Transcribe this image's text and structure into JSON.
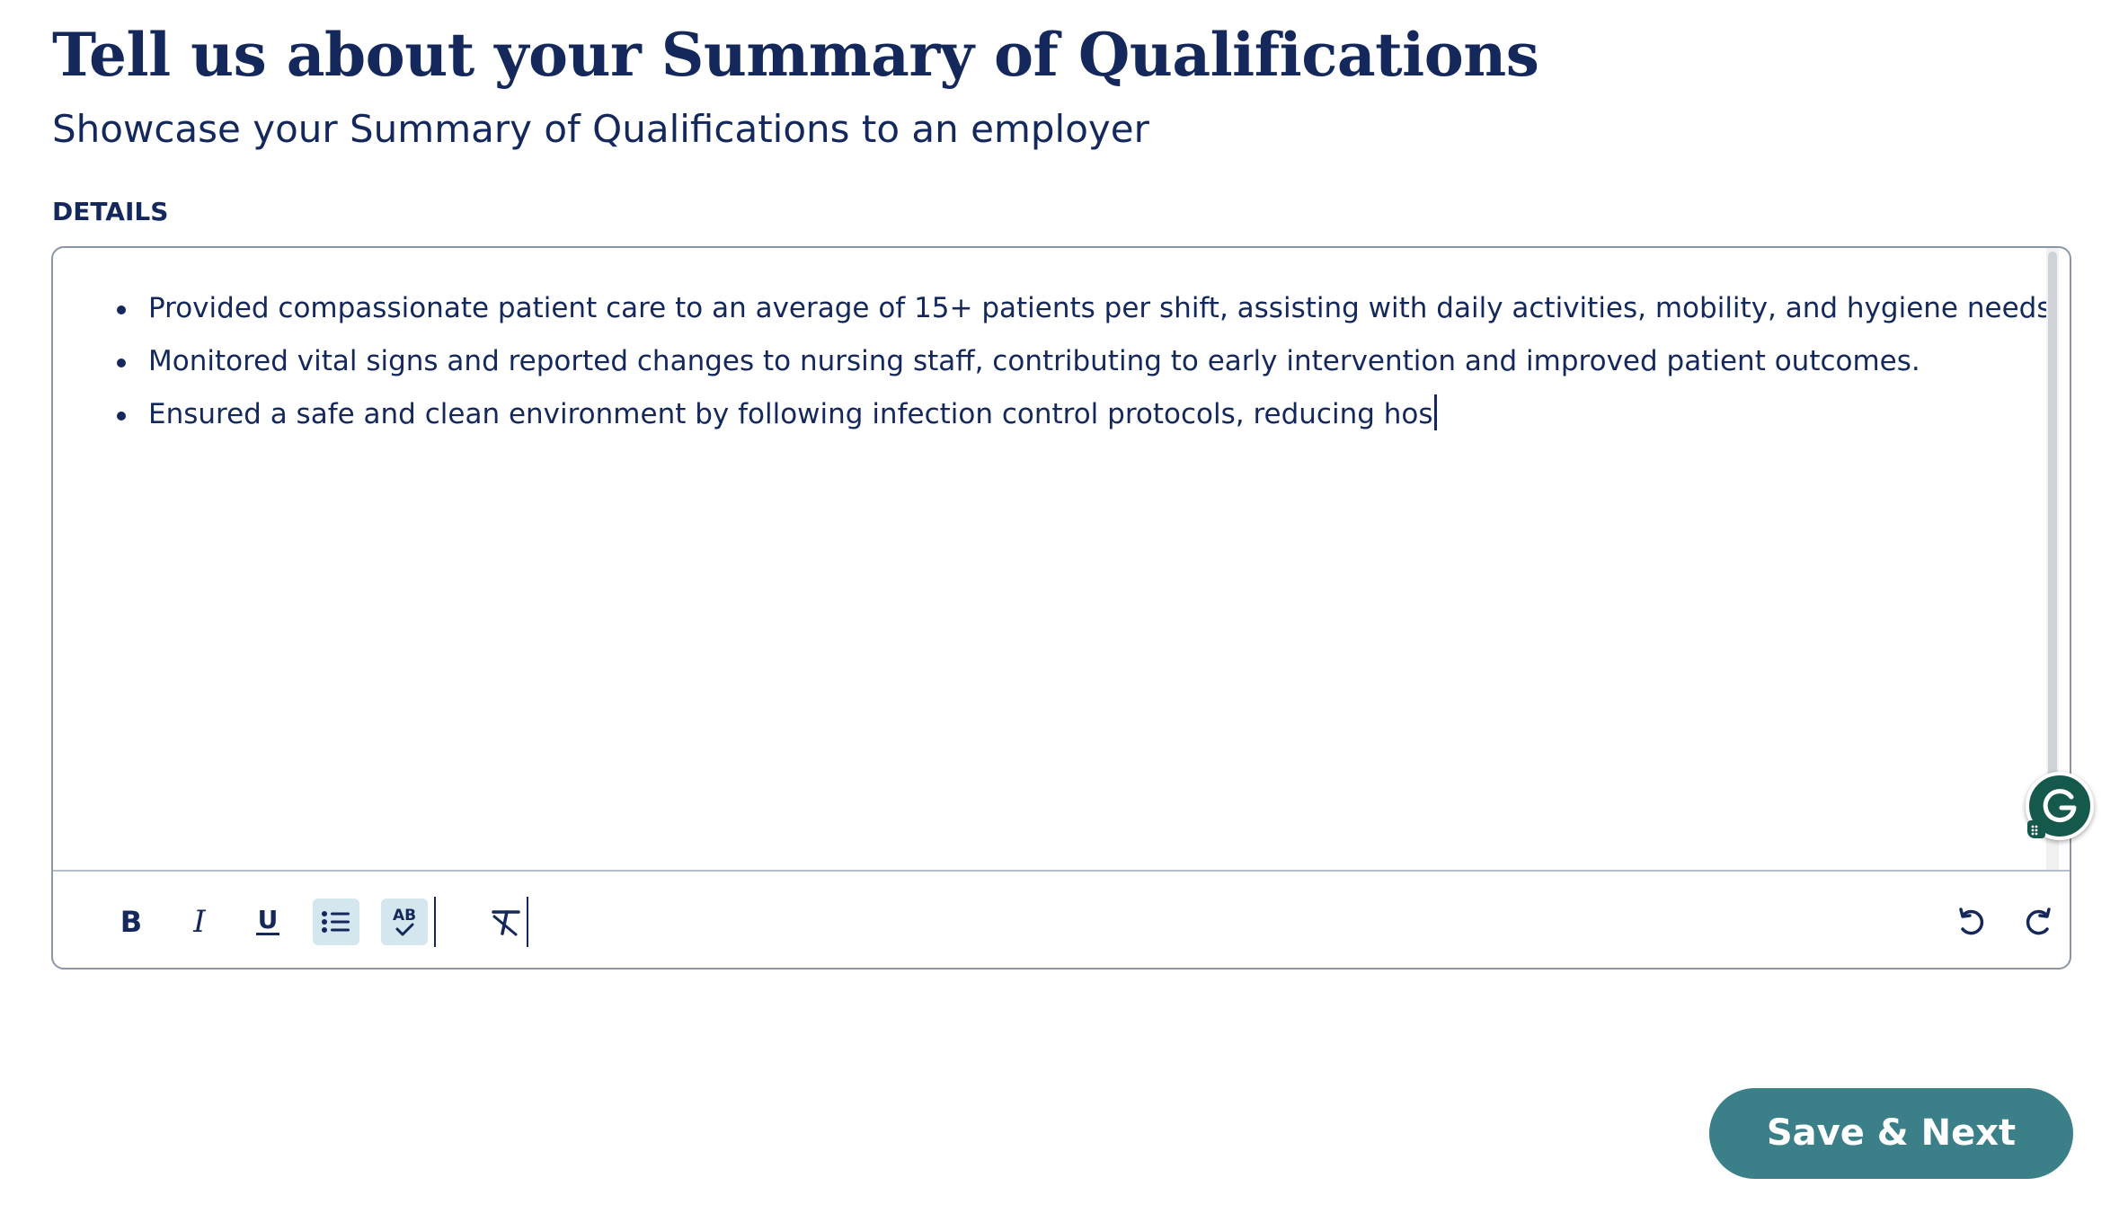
{
  "header": {
    "title": "Tell us about your Summary of Qualifications",
    "subtitle": "Showcase your Summary of Qualifications to an employer"
  },
  "section": {
    "label": "DETAILS"
  },
  "editor": {
    "bullets": [
      "Provided compassionate patient care to an average of 15+ patients per shift, assisting with daily activities, mobility, and hygiene needs.",
      "Monitored vital signs and reported changes to nursing staff, contributing to early intervention and improved patient outcomes.",
      "Ensured a safe and clean environment by following infection control protocols, reducing hos"
    ],
    "toolbar": {
      "bold_label": "B",
      "italic_label": "I",
      "underline_label": "U",
      "spellcheck_label": "AB",
      "active_tools": [
        "bullet-list",
        "spellcheck"
      ],
      "icons": {
        "bold": "bold-icon",
        "italic": "italic-icon",
        "underline": "underline-icon",
        "bullet_list": "bullet-list-icon",
        "spellcheck": "spellcheck-icon",
        "clear_format": "clear-format-icon",
        "undo": "undo-icon",
        "redo": "redo-icon"
      }
    }
  },
  "actions": {
    "save_next_label": "Save & Next"
  },
  "colors": {
    "text_primary": "#14285c",
    "button_bg": "#3b7f89",
    "active_tool_bg": "#d4e6ee",
    "grammarly_green": "#15594c",
    "editor_border": "#8a97a8"
  }
}
